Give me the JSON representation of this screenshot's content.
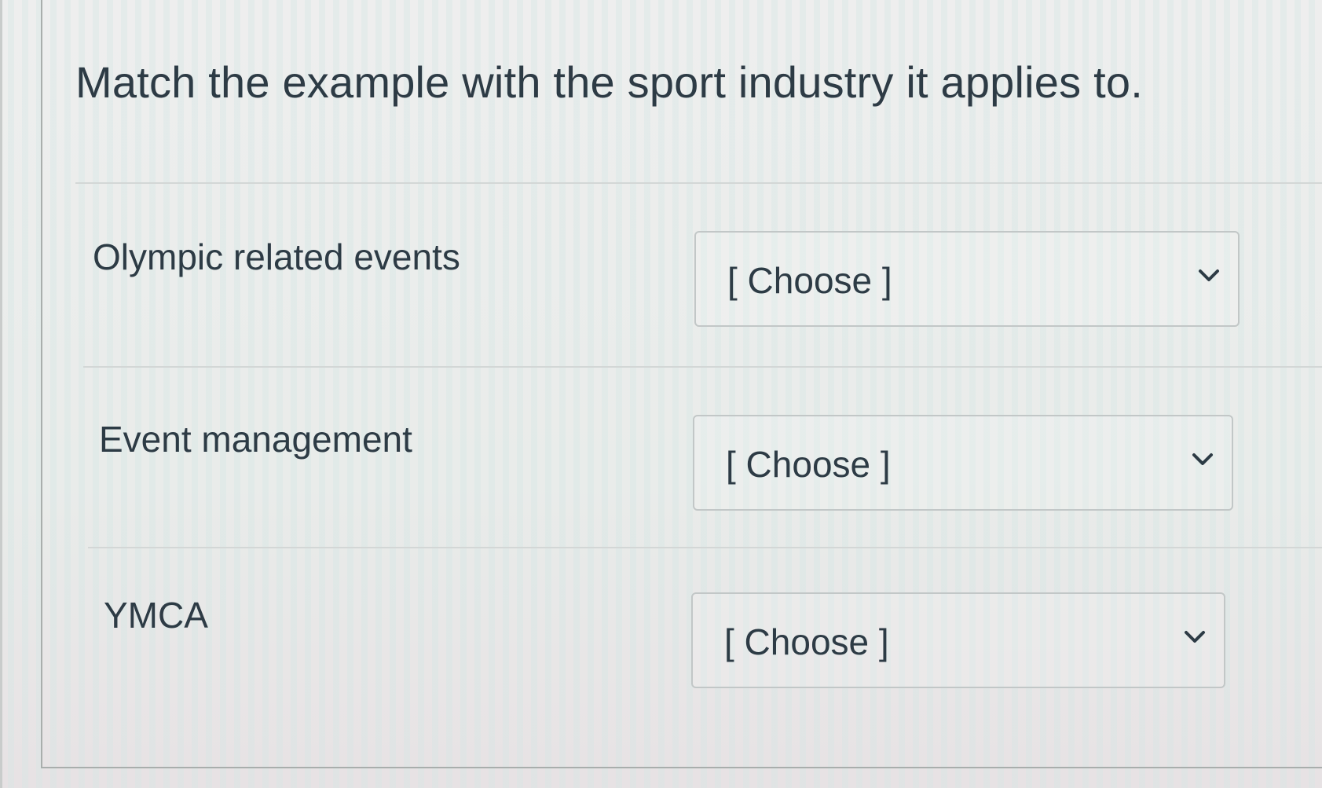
{
  "question": {
    "title": "Match the example with the sport industry it applies to."
  },
  "rows": [
    {
      "label": "Olympic related events",
      "selected": "[ Choose ]",
      "icon": "chevron-down-icon"
    },
    {
      "label": "Event management",
      "selected": "[ Choose ]",
      "icon": "chevron-down-icon"
    },
    {
      "label": "YMCA",
      "selected": "[ Choose ]",
      "icon": "chevron-down-icon"
    }
  ],
  "colors": {
    "text": "#2d3b45",
    "border": "#c2c7c7",
    "divider": "#d3d7d6"
  }
}
